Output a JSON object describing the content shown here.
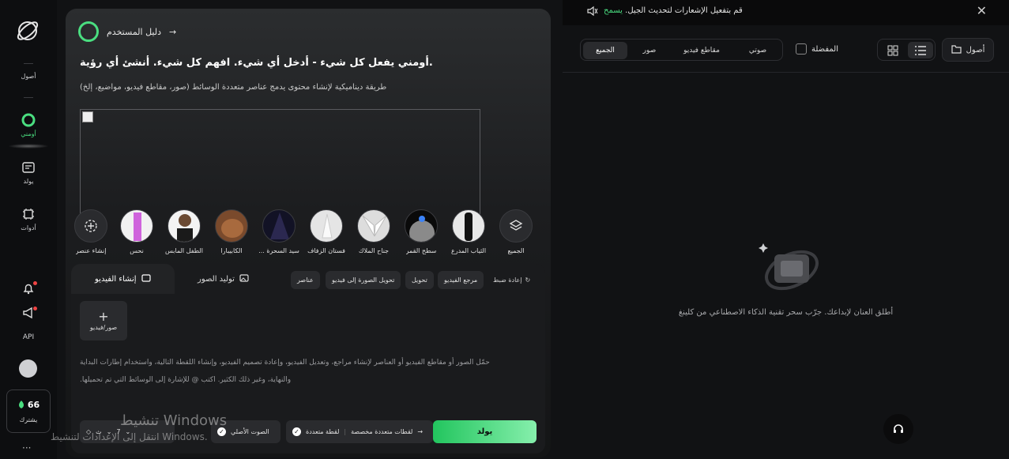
{
  "sidebar": {
    "items": [
      {
        "label": "أصول",
        "icon": "assets-icon"
      },
      {
        "label": "أومني",
        "icon": "omni-icon"
      },
      {
        "label": "يولد",
        "icon": "generate-icon"
      },
      {
        "label": "أدوات",
        "icon": "tools-icon"
      },
      {
        "label": "API",
        "icon": "api-icon"
      }
    ],
    "credits_value": "66",
    "credits_label": "يشترك"
  },
  "main": {
    "guide_label": "دليل المستخدم",
    "title": "أومني يفعل كل شيء - أدخل أي شيء. افهم كل شيء. أنشئ أي رؤية.",
    "subtitle": "طريقة ديناميكية لإنشاء محتوى يدمج عناصر متعددة الوسائط (صور، مقاطع فيديو، مواضيع، إلخ)",
    "chips": [
      "الجميع",
      "الثياب المدرع",
      "سطح القمر",
      "جناح الملاك",
      "فستان الزفاف",
      "... سيد السحرة",
      "الكابيبارا",
      "الطفل المابس",
      "نحس",
      "إنشاء عنصر"
    ],
    "tabs": {
      "video": "إنشاء الفيديو",
      "image": "توليد الصور"
    },
    "pills": [
      "مرجع الفيديو",
      "تحويل",
      "تحويل الصورة إلى فيديو",
      "عناصر"
    ],
    "reset_label": "إعادة ضبط",
    "upload_label": "صور/فيديو",
    "hint_line1": "حمّل الصور أو مقاطع الفيديو أو العناصر لإنشاء مراجع، وتعديل الفيديو، وإعادة تصميم الفيديو، وإنشاء اللقطة التالية، واستخدام إطارات البداية",
    "hint_line2": "والنهاية، وغير ذلك الكثير. اكتب @ للإشارة إلى الوسائط التي تم تحميلها.",
    "bottom": {
      "multishot_custom": "لقطات متعددة مخصصة",
      "multishot": "لقطة متعددة",
      "audio": "الصوت الأصلي",
      "duration": "7",
      "ratio": "ث",
      "generate": "يولد"
    }
  },
  "right": {
    "notice_allow": "يسمح",
    "notice_text": "قم بتفعيل الإشعارات لتحديث الجيل.",
    "segments": [
      "الجميع",
      "صور",
      "مقاطع فيديو",
      "صوتي"
    ],
    "favorites": "المفضلة",
    "assets_button": "أصول",
    "empty_text": "أطلق العنان لإبداعك. جرّب سحر تقنية الذكاء الاصطناعي من كلينغ"
  },
  "watermark": {
    "line1": "تنشيط Windows",
    "line2": "انتقل إلى الإعدادات لتنشيط Windows."
  },
  "colors": {
    "accent": "#4ade80",
    "background": "#111214"
  }
}
